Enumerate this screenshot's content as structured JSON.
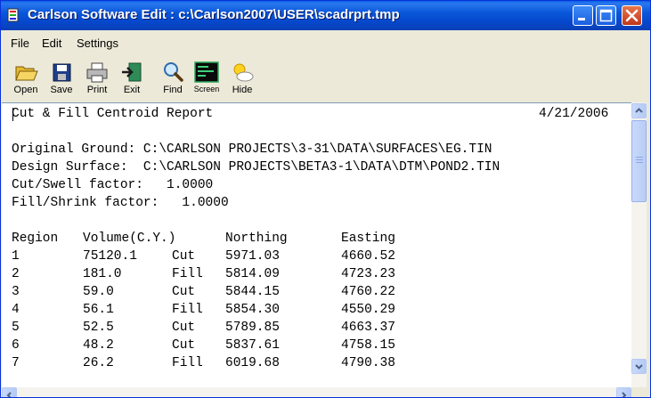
{
  "window": {
    "title": "Carlson Software Edit : c:\\Carlson2007\\USER\\scadrprt.tmp"
  },
  "menu": [
    {
      "label": "File"
    },
    {
      "label": "Edit"
    },
    {
      "label": "Settings"
    }
  ],
  "toolbar": [
    {
      "label": "Open",
      "icon": "folder-open-icon"
    },
    {
      "label": "Save",
      "icon": "floppy-disk-icon"
    },
    {
      "label": "Print",
      "icon": "printer-icon"
    },
    {
      "label": "Exit",
      "icon": "exit-door-icon"
    },
    {
      "label": "Find",
      "icon": "magnifier-icon"
    },
    {
      "label": "Screen",
      "icon": "terminal-screen-icon"
    },
    {
      "label": "Hide",
      "icon": "sun-cloud-icon"
    }
  ],
  "report": {
    "title": "Cut & Fill Centroid Report",
    "date": "4/21/2006",
    "original_ground": "Original Ground: C:\\CARLSON PROJECTS\\3-31\\DATA\\SURFACES\\EG.TIN",
    "design_surface": "Design Surface:  C:\\CARLSON PROJECTS\\BETA3-1\\DATA\\DTM\\POND2.TIN",
    "cut_swell": "Cut/Swell factor:   1.0000",
    "fill_shrink": "Fill/Shrink factor:   1.0000",
    "headers": [
      "Region",
      "Volume(C.Y.)",
      "Northing",
      "Easting"
    ],
    "rows": [
      {
        "region": "1",
        "volume": "75120.1",
        "type": "Cut",
        "northing": "5971.03",
        "easting": "4660.52"
      },
      {
        "region": "2",
        "volume": "181.0",
        "type": "Fill",
        "northing": "5814.09",
        "easting": "4723.23"
      },
      {
        "region": "3",
        "volume": "59.0",
        "type": "Cut",
        "northing": "5844.15",
        "easting": "4760.22"
      },
      {
        "region": "4",
        "volume": "56.1",
        "type": "Fill",
        "northing": "5854.30",
        "easting": "4550.29"
      },
      {
        "region": "5",
        "volume": "52.5",
        "type": "Cut",
        "northing": "5789.85",
        "easting": "4663.37"
      },
      {
        "region": "6",
        "volume": "48.2",
        "type": "Cut",
        "northing": "5837.61",
        "easting": "4758.15"
      },
      {
        "region": "7",
        "volume": "26.2",
        "type": "Fill",
        "northing": "6019.68",
        "easting": "4790.38"
      }
    ]
  },
  "colors": {
    "titlebar": "#0a57da",
    "window_face": "#ece9d8",
    "close_button": "#c1361a"
  }
}
